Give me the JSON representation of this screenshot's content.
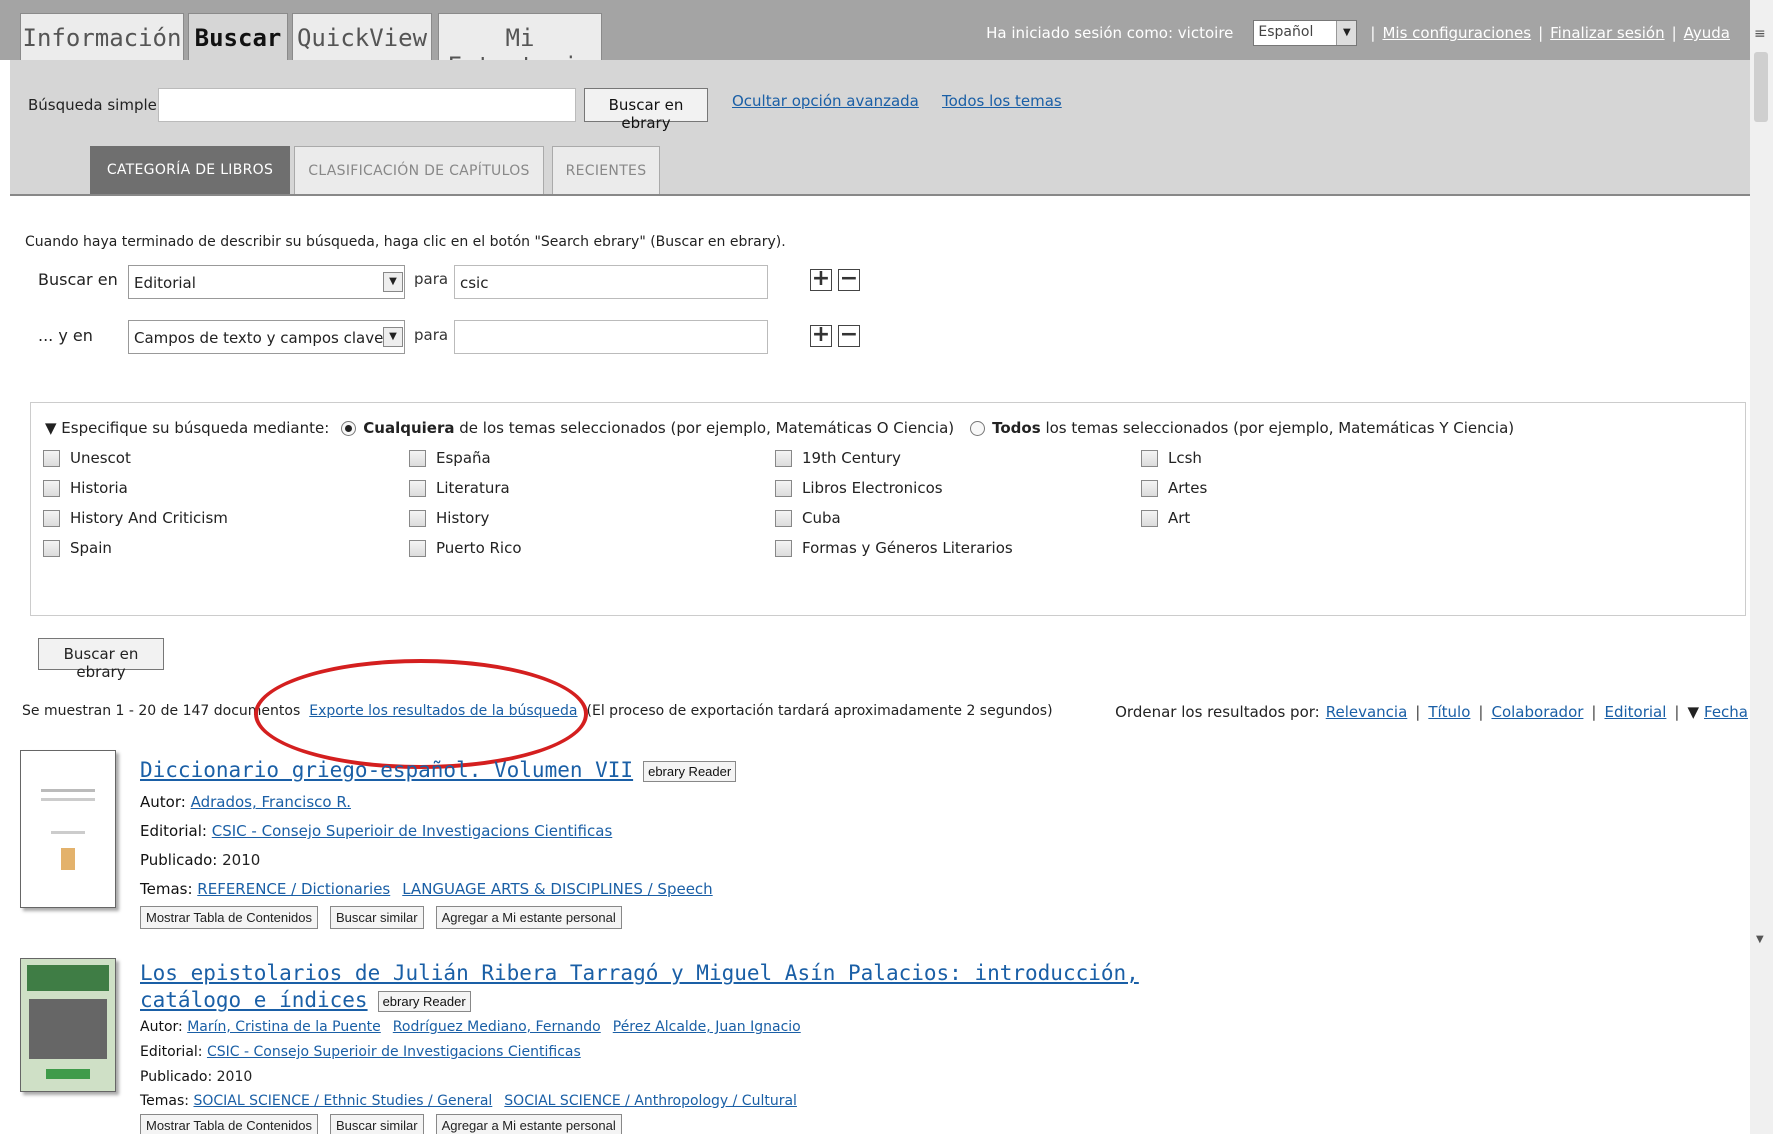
{
  "tabs": [
    {
      "label": "Información"
    },
    {
      "label": "Buscar"
    },
    {
      "label": "QuickView"
    },
    {
      "label": "Mi Estanteria"
    }
  ],
  "userbar": {
    "logged_in": "Ha iniciado sesión como: victoire",
    "language": "Español",
    "settings": "Mis configuraciones",
    "logout": "Finalizar sesión",
    "help": "Ayuda"
  },
  "simple_search": {
    "label": "Búsqueda simple:",
    "value": "",
    "button": "Buscar en ebrary",
    "hide_advanced": "Ocultar opción avanzada",
    "all_topics": "Todos los temas"
  },
  "subtabs": [
    "CATEGORÍA DE LIBROS",
    "CLASIFICACIÓN DE CAPÍTULOS",
    "RECIENTES"
  ],
  "advanced": {
    "instructions": "Cuando haya terminado de describir su búsqueda, haga clic en el botón \"Search ebrary\" (Buscar en ebrary).",
    "rows": [
      {
        "label": "Buscar en",
        "field": "Editorial",
        "para": "para",
        "value": "csic"
      },
      {
        "label": "... y en",
        "field": "Campos de texto y campos clave",
        "para": "para",
        "value": ""
      }
    ]
  },
  "filter": {
    "heading": "▼ Especifique su búsqueda mediante:",
    "any_bold": "Cualquiera",
    "any_rest": "de los temas seleccionados (por ejemplo, Matemáticas O Ciencia)",
    "all_bold": "Todos",
    "all_rest": "los temas seleccionados (por ejemplo, Matemáticas Y Ciencia)",
    "columns": [
      [
        "Unescot",
        "Historia",
        "History And Criticism",
        "Spain"
      ],
      [
        "España",
        "Literatura",
        "History",
        "Puerto Rico"
      ],
      [
        "19th Century",
        "Libros Electronicos",
        "Cuba",
        "Formas y Géneros Literarios"
      ],
      [
        "Lcsh",
        "Artes",
        "Art"
      ]
    ]
  },
  "search_button": "Buscar en ebrary",
  "results": {
    "count": "Se muestran 1 - 20 de 147 documentos",
    "export": "Exporte los resultados de la búsqueda",
    "export_note": "(El proceso de exportación tardará aproximadamente 2  segundos)",
    "sort_label": "Ordenar los resultados por:",
    "sort": [
      "Relevancia",
      "Título",
      "Colaborador",
      "Editorial",
      "Fecha"
    ],
    "sort_arrow": "▼"
  },
  "labels": {
    "author": "Autor:",
    "publisher": "Editorial:",
    "published": "Publicado:",
    "topics": "Temas:",
    "reader": "ebrary Reader",
    "toc": "Mostrar Tabla de Contenidos",
    "similar": "Buscar similar",
    "shelf": "Agregar a Mi estante personal"
  },
  "items": [
    {
      "title": "Diccionario griego-español. Volumen VII",
      "authors": [
        "Adrados, Francisco R."
      ],
      "publisher": "CSIC - Consejo Superioir de Investigacions Cientificas",
      "year": "2010",
      "topics": [
        "REFERENCE / Dictionaries",
        "LANGUAGE ARTS & DISCIPLINES / Speech"
      ]
    },
    {
      "title1": "Los epistolarios de Julián Ribera Tarragó y Miguel Asín Palacios: introducción,",
      "title2": "catálogo e índices",
      "authors": [
        "Marín, Cristina de la Puente",
        "Rodríguez Mediano, Fernando",
        "Pérez Alcalde, Juan Ignacio"
      ],
      "publisher": "CSIC - Consejo Superioir de Investigacions Cientificas",
      "year": "2010",
      "topics": [
        "SOCIAL SCIENCE / Ethnic Studies / General",
        "SOCIAL SCIENCE / Anthropology / Cultural"
      ]
    }
  ]
}
